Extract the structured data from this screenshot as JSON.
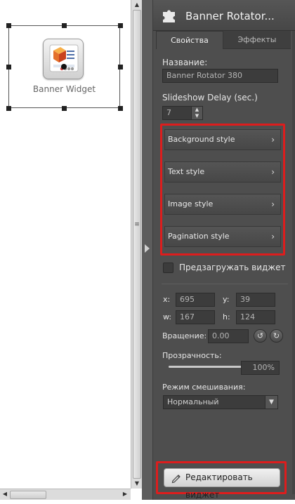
{
  "canvas": {
    "widget_label": "Banner Widget"
  },
  "panel": {
    "title": "Banner Rotator...",
    "tabs": [
      {
        "label": "Свойства",
        "active": true
      },
      {
        "label": "Эффекты",
        "active": false
      }
    ],
    "name_label": "Название:",
    "name_value": "Banner Rotator 380",
    "delay_label": "Slideshow Delay (sec.)",
    "delay_value": "7",
    "style_buttons": [
      {
        "label": "Background style"
      },
      {
        "label": "Text style"
      },
      {
        "label": "Image style"
      },
      {
        "label": "Pagination style"
      }
    ],
    "preload_label": "Предзагружать виджет",
    "preload_checked": false,
    "geometry": {
      "x_label": "x:",
      "x_value": "695",
      "y_label": "y:",
      "y_value": "39",
      "w_label": "w:",
      "w_value": "167",
      "h_label": "h:",
      "h_value": "124"
    },
    "rotation_label": "Вращение:",
    "rotation_value": "0.00",
    "opacity_label": "Прозрачность:",
    "opacity_value": "100%",
    "opacity_fraction": 1.0,
    "blend_label": "Режим смешивания:",
    "blend_value": "Нормальный",
    "edit_button_label": "Редактировать виджет"
  },
  "colors": {
    "panel_bg": "#4e4e4e",
    "highlight": "#dd1d1d"
  }
}
